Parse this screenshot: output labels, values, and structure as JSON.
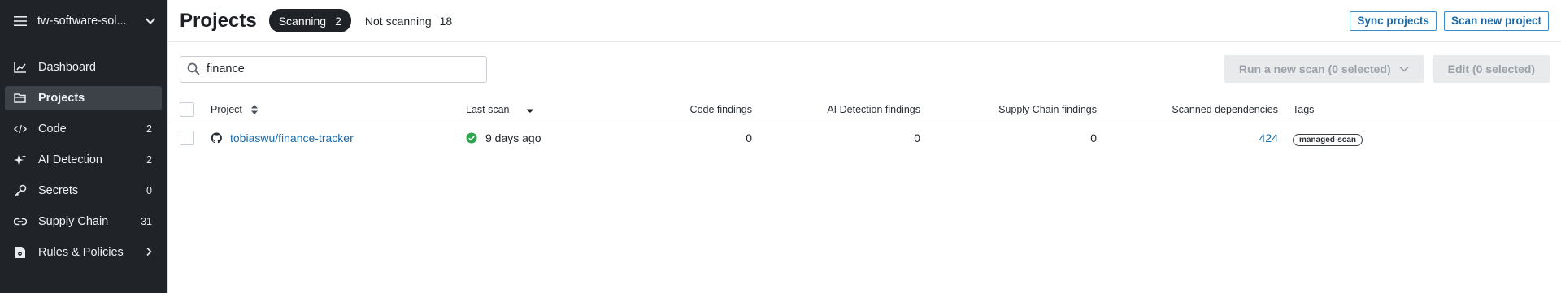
{
  "sidebar": {
    "org_name": "tw-software-sol...",
    "items": [
      {
        "label": "Dashboard",
        "count": "",
        "icon": "chart-icon"
      },
      {
        "label": "Projects",
        "count": "",
        "icon": "folder-icon"
      },
      {
        "label": "Code",
        "count": "2",
        "icon": "code-icon"
      },
      {
        "label": "AI Detection",
        "count": "2",
        "icon": "sparkle-icon"
      },
      {
        "label": "Secrets",
        "count": "0",
        "icon": "key-icon"
      },
      {
        "label": "Supply Chain",
        "count": "31",
        "icon": "link-icon"
      },
      {
        "label": "Rules & Policies",
        "count": "",
        "icon": "policy-icon"
      }
    ]
  },
  "header": {
    "title": "Projects",
    "filters": [
      {
        "label": "Scanning",
        "count": "2"
      },
      {
        "label": "Not scanning",
        "count": "18"
      }
    ],
    "sync_label": "Sync projects",
    "scan_new_label": "Scan new project"
  },
  "toolbar": {
    "search_value": "finance",
    "run_scan_label": "Run a new scan (0 selected)",
    "edit_label": "Edit (0 selected)"
  },
  "table": {
    "columns": [
      "Project",
      "Last scan",
      "Code findings",
      "AI Detection findings",
      "Supply Chain findings",
      "Scanned dependencies",
      "Tags"
    ],
    "rows": [
      {
        "project": "tobiaswu/finance-tracker",
        "last_scan": "9 days ago",
        "code_findings": "0",
        "ai_findings": "0",
        "supply_chain_findings": "0",
        "scanned_dependencies": "424",
        "tag": "managed-scan"
      }
    ]
  },
  "colors": {
    "sidebar_bg": "#202328",
    "accent": "#1b6aa8",
    "success": "#2ea44f"
  }
}
